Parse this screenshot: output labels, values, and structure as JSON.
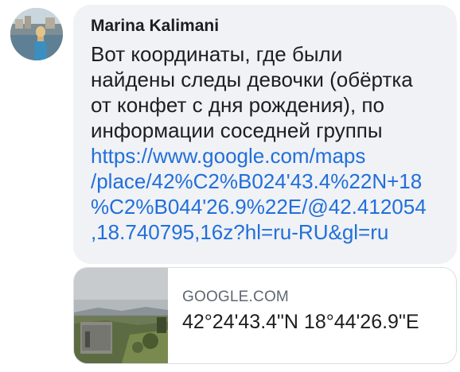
{
  "post": {
    "sender_name": "Marina Kalimani",
    "message_lines": [
      "Вот координаты, где были",
      "найдены следы девочки (обёртка",
      "от конфет с дня рождения), по",
      "информации соседней группы"
    ],
    "link_lines": [
      "https://www.google.com/maps",
      "/place/42%C2%B024'43.4%22N+18",
      "%C2%B044'26.9%22E/@42.412054",
      ",18.740795,16z?hl=ru-RU&gl=ru"
    ]
  },
  "link_preview": {
    "domain": "GOOGLE.COM",
    "title": "42°24'43.4\"N 18°44'26.9\"E"
  },
  "colors": {
    "bubble_bg": "#f0f2f5",
    "link": "#216fdb",
    "text": "#1c1e21",
    "muted": "#606770"
  }
}
